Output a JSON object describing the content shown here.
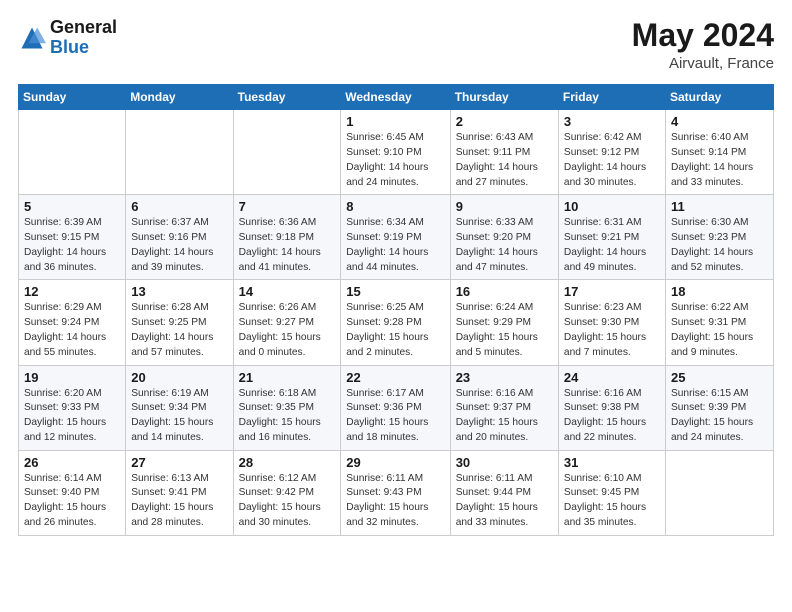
{
  "header": {
    "logo_general": "General",
    "logo_blue": "Blue",
    "month": "May 2024",
    "location": "Airvault, France"
  },
  "days_of_week": [
    "Sunday",
    "Monday",
    "Tuesday",
    "Wednesday",
    "Thursday",
    "Friday",
    "Saturday"
  ],
  "weeks": [
    [
      {
        "day": "",
        "info": ""
      },
      {
        "day": "",
        "info": ""
      },
      {
        "day": "",
        "info": ""
      },
      {
        "day": "1",
        "info": "Sunrise: 6:45 AM\nSunset: 9:10 PM\nDaylight: 14 hours\nand 24 minutes."
      },
      {
        "day": "2",
        "info": "Sunrise: 6:43 AM\nSunset: 9:11 PM\nDaylight: 14 hours\nand 27 minutes."
      },
      {
        "day": "3",
        "info": "Sunrise: 6:42 AM\nSunset: 9:12 PM\nDaylight: 14 hours\nand 30 minutes."
      },
      {
        "day": "4",
        "info": "Sunrise: 6:40 AM\nSunset: 9:14 PM\nDaylight: 14 hours\nand 33 minutes."
      }
    ],
    [
      {
        "day": "5",
        "info": "Sunrise: 6:39 AM\nSunset: 9:15 PM\nDaylight: 14 hours\nand 36 minutes."
      },
      {
        "day": "6",
        "info": "Sunrise: 6:37 AM\nSunset: 9:16 PM\nDaylight: 14 hours\nand 39 minutes."
      },
      {
        "day": "7",
        "info": "Sunrise: 6:36 AM\nSunset: 9:18 PM\nDaylight: 14 hours\nand 41 minutes."
      },
      {
        "day": "8",
        "info": "Sunrise: 6:34 AM\nSunset: 9:19 PM\nDaylight: 14 hours\nand 44 minutes."
      },
      {
        "day": "9",
        "info": "Sunrise: 6:33 AM\nSunset: 9:20 PM\nDaylight: 14 hours\nand 47 minutes."
      },
      {
        "day": "10",
        "info": "Sunrise: 6:31 AM\nSunset: 9:21 PM\nDaylight: 14 hours\nand 49 minutes."
      },
      {
        "day": "11",
        "info": "Sunrise: 6:30 AM\nSunset: 9:23 PM\nDaylight: 14 hours\nand 52 minutes."
      }
    ],
    [
      {
        "day": "12",
        "info": "Sunrise: 6:29 AM\nSunset: 9:24 PM\nDaylight: 14 hours\nand 55 minutes."
      },
      {
        "day": "13",
        "info": "Sunrise: 6:28 AM\nSunset: 9:25 PM\nDaylight: 14 hours\nand 57 minutes."
      },
      {
        "day": "14",
        "info": "Sunrise: 6:26 AM\nSunset: 9:27 PM\nDaylight: 15 hours\nand 0 minutes."
      },
      {
        "day": "15",
        "info": "Sunrise: 6:25 AM\nSunset: 9:28 PM\nDaylight: 15 hours\nand 2 minutes."
      },
      {
        "day": "16",
        "info": "Sunrise: 6:24 AM\nSunset: 9:29 PM\nDaylight: 15 hours\nand 5 minutes."
      },
      {
        "day": "17",
        "info": "Sunrise: 6:23 AM\nSunset: 9:30 PM\nDaylight: 15 hours\nand 7 minutes."
      },
      {
        "day": "18",
        "info": "Sunrise: 6:22 AM\nSunset: 9:31 PM\nDaylight: 15 hours\nand 9 minutes."
      }
    ],
    [
      {
        "day": "19",
        "info": "Sunrise: 6:20 AM\nSunset: 9:33 PM\nDaylight: 15 hours\nand 12 minutes."
      },
      {
        "day": "20",
        "info": "Sunrise: 6:19 AM\nSunset: 9:34 PM\nDaylight: 15 hours\nand 14 minutes."
      },
      {
        "day": "21",
        "info": "Sunrise: 6:18 AM\nSunset: 9:35 PM\nDaylight: 15 hours\nand 16 minutes."
      },
      {
        "day": "22",
        "info": "Sunrise: 6:17 AM\nSunset: 9:36 PM\nDaylight: 15 hours\nand 18 minutes."
      },
      {
        "day": "23",
        "info": "Sunrise: 6:16 AM\nSunset: 9:37 PM\nDaylight: 15 hours\nand 20 minutes."
      },
      {
        "day": "24",
        "info": "Sunrise: 6:16 AM\nSunset: 9:38 PM\nDaylight: 15 hours\nand 22 minutes."
      },
      {
        "day": "25",
        "info": "Sunrise: 6:15 AM\nSunset: 9:39 PM\nDaylight: 15 hours\nand 24 minutes."
      }
    ],
    [
      {
        "day": "26",
        "info": "Sunrise: 6:14 AM\nSunset: 9:40 PM\nDaylight: 15 hours\nand 26 minutes."
      },
      {
        "day": "27",
        "info": "Sunrise: 6:13 AM\nSunset: 9:41 PM\nDaylight: 15 hours\nand 28 minutes."
      },
      {
        "day": "28",
        "info": "Sunrise: 6:12 AM\nSunset: 9:42 PM\nDaylight: 15 hours\nand 30 minutes."
      },
      {
        "day": "29",
        "info": "Sunrise: 6:11 AM\nSunset: 9:43 PM\nDaylight: 15 hours\nand 32 minutes."
      },
      {
        "day": "30",
        "info": "Sunrise: 6:11 AM\nSunset: 9:44 PM\nDaylight: 15 hours\nand 33 minutes."
      },
      {
        "day": "31",
        "info": "Sunrise: 6:10 AM\nSunset: 9:45 PM\nDaylight: 15 hours\nand 35 minutes."
      },
      {
        "day": "",
        "info": ""
      }
    ]
  ]
}
